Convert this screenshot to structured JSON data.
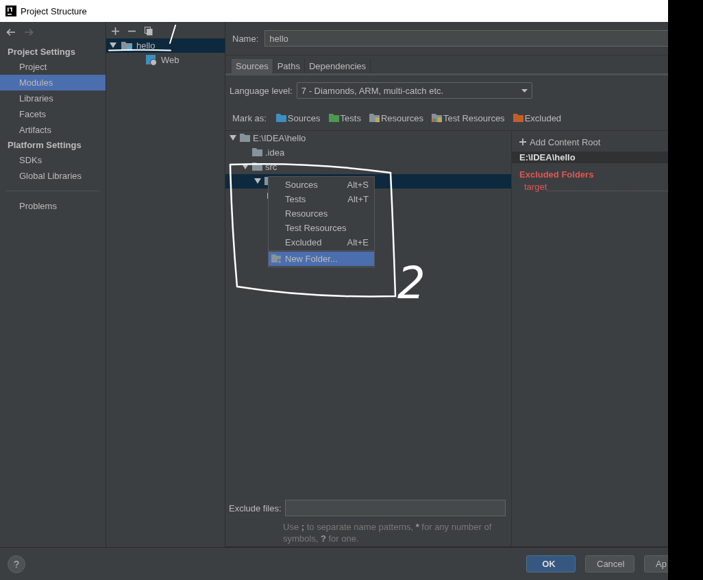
{
  "window": {
    "title": "Project Structure"
  },
  "sidebar": {
    "sections": [
      {
        "title": "Project Settings",
        "items": [
          {
            "label": "Project",
            "selected": false
          },
          {
            "label": "Modules",
            "selected": true
          },
          {
            "label": "Libraries",
            "selected": false
          },
          {
            "label": "Facets",
            "selected": false
          },
          {
            "label": "Artifacts",
            "selected": false
          }
        ]
      },
      {
        "title": "Platform Settings",
        "items": [
          {
            "label": "SDKs",
            "selected": false
          },
          {
            "label": "Global Libraries",
            "selected": false
          }
        ]
      }
    ],
    "footer_items": [
      {
        "label": "Problems",
        "selected": false
      }
    ]
  },
  "modules_tree": {
    "items": [
      {
        "label": "hello",
        "selected": true,
        "expanded": true,
        "children": [
          {
            "label": "Web",
            "selected": false
          }
        ]
      }
    ]
  },
  "name_field": {
    "label": "Name:",
    "value": "hello"
  },
  "tabs": [
    {
      "label": "Sources",
      "selected": true
    },
    {
      "label": "Paths",
      "selected": false
    },
    {
      "label": "Dependencies",
      "selected": false
    }
  ],
  "language_level": {
    "label": "Language level:",
    "value": "7 - Diamonds, ARM, multi-catch etc."
  },
  "mark_as": {
    "label": "Mark as:",
    "options": [
      {
        "label": "Sources",
        "kind": "source"
      },
      {
        "label": "Tests",
        "kind": "test"
      },
      {
        "label": "Resources",
        "kind": "resource"
      },
      {
        "label": "Test Resources",
        "kind": "test-resource"
      },
      {
        "label": "Excluded",
        "kind": "excluded"
      }
    ]
  },
  "content_tree": {
    "items": [
      {
        "label": "E:\\IDEA\\hello",
        "selected": false,
        "expanded": true,
        "children": [
          {
            "label": ".idea",
            "selected": false
          },
          {
            "label": "src",
            "selected": false,
            "expanded": true,
            "children": [
              {
                "selected": true,
                "expanded": true,
                "children": [
                  {
                    "selected": false,
                    "expanded": false
                  }
                ]
              }
            ]
          }
        ]
      }
    ]
  },
  "context_menu": {
    "items": [
      {
        "label": "Sources",
        "shortcut": "Alt+S",
        "selected": false,
        "kind": "mark"
      },
      {
        "label": "Tests",
        "shortcut": "Alt+T",
        "selected": false,
        "kind": "mark"
      },
      {
        "label": "Resources",
        "selected": false,
        "kind": "mark"
      },
      {
        "label": "Test Resources",
        "selected": false,
        "kind": "mark"
      },
      {
        "label": "Excluded",
        "shortcut": "Alt+E",
        "selected": false,
        "kind": "mark"
      },
      {
        "label": "New Folder...",
        "selected": true,
        "kind": "new-folder"
      }
    ]
  },
  "content_roots": {
    "add_label": "Add Content Root",
    "root": "E:\\IDEA\\hello",
    "excluded_title": "Excluded Folders",
    "excluded": [
      "target"
    ]
  },
  "exclude_files": {
    "label": "Exclude files:",
    "hint": [
      {
        "text": "Use ",
        "bold": false
      },
      {
        "text": ";",
        "bold": true
      },
      {
        "text": " to separate name patterns, ",
        "bold": false
      },
      {
        "text": "*",
        "bold": true
      },
      {
        "text": " for any number of symbols, ",
        "bold": false
      },
      {
        "text": "?",
        "bold": true
      },
      {
        "text": " for one.",
        "bold": false
      }
    ]
  },
  "buttons": [
    {
      "label": "OK",
      "kind": "primary"
    },
    {
      "label": "Cancel",
      "kind": "normal"
    },
    {
      "label": "Ap",
      "kind": "normal"
    }
  ],
  "help": {
    "label": "?"
  },
  "annotations": {
    "digit": "2"
  }
}
